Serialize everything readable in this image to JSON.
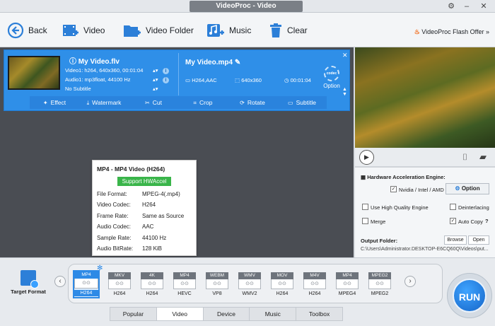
{
  "window": {
    "title": "VideoProc - Video"
  },
  "toolbar": {
    "back": "Back",
    "video": "Video",
    "video_folder": "Video Folder",
    "music": "Music",
    "clear": "Clear",
    "promo": "VideoProc Flash Offer »"
  },
  "video_item": {
    "source_name": "My Video.flv",
    "video_info": "Video1: h264, 640x360, 00:01:04",
    "audio_info": "Audio1: mp3float, 44100 Hz",
    "subtitle": "No Subtitle",
    "output_name": "My Video.mp4",
    "codec": "H264,AAC",
    "resolution": "640x360",
    "duration": "00:01:04",
    "codec_badge": "codec",
    "option_label": "Option",
    "edit_tabs": [
      "Effect",
      "Watermark",
      "Cut",
      "Crop",
      "Rotate",
      "Subtitle"
    ]
  },
  "format_popup": {
    "title": "MP4 - MP4 Video (H264)",
    "badge": "Support HWAccel",
    "rows": [
      {
        "k": "File Format:",
        "v": "MPEG-4(.mp4)"
      },
      {
        "k": "Video Codec:",
        "v": "H264"
      },
      {
        "k": "Frame Rate:",
        "v": "Same as Source"
      },
      {
        "k": "Audio Codec:",
        "v": "AAC"
      },
      {
        "k": "Sample Rate:",
        "v": "44100 Hz"
      },
      {
        "k": "Audio BitRate:",
        "v": "128 KiB"
      }
    ]
  },
  "settings": {
    "hw_title": "Hardware Acceleration Engine:",
    "hw_vendor": "Nvidia / Intel / AMD",
    "option_button": "Option",
    "high_quality": "Use High Quality Engine",
    "deinterlacing": "Deinterlacing",
    "merge": "Merge",
    "auto_copy": "Auto Copy",
    "output_folder_label": "Output Folder:",
    "browse": "Browse",
    "open": "Open",
    "output_path": "C:\\Users\\Administrator.DESKTOP-E6CQ60Q\\Videos\\put..."
  },
  "bottom": {
    "target_format": "Target Format",
    "formats": [
      {
        "tag": "MP4",
        "label": "H264",
        "selected": true
      },
      {
        "tag": "MKV",
        "label": "H264"
      },
      {
        "tag": "4K",
        "label": "H264"
      },
      {
        "tag": "MP4",
        "label": "HEVC"
      },
      {
        "tag": "WEBM",
        "label": "VP8"
      },
      {
        "tag": "WMV",
        "label": "WMV2"
      },
      {
        "tag": "MOV",
        "label": "H264"
      },
      {
        "tag": "M4V",
        "label": "H264"
      },
      {
        "tag": "MP4",
        "label": "MPEG4"
      },
      {
        "tag": "MPEG2",
        "label": "MPEG2"
      }
    ],
    "tabs": [
      "Popular",
      "Video",
      "Device",
      "Music",
      "Toolbox"
    ],
    "active_tab": "Video",
    "run": "RUN"
  },
  "colors": {
    "accent": "#2f8fe8",
    "hw_badge": "#3ab54a",
    "promo": "#f26b1a"
  }
}
